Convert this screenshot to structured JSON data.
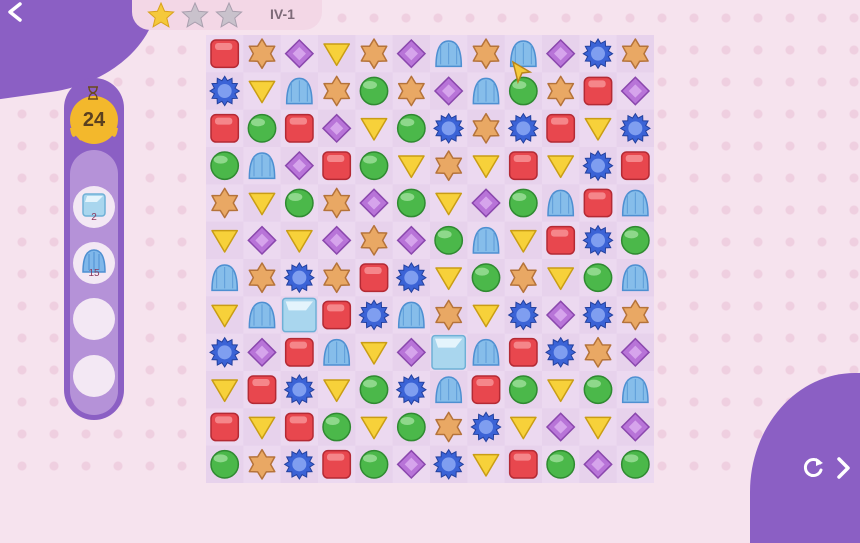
{
  "header": {
    "level_label": "IV-1",
    "stars_earned": 1,
    "stars_total": 3
  },
  "side_panel": {
    "moves_left": "24",
    "goals": [
      {
        "icon": "ice-block-icon",
        "count": "2"
      },
      {
        "icon": "blue-jelly-icon",
        "count": "15"
      },
      {
        "icon": "",
        "count": ""
      },
      {
        "icon": "",
        "count": ""
      }
    ]
  },
  "board": {
    "rows": 12,
    "cols": 12,
    "grid": [
      [
        "red-square",
        "orange-star",
        "purple-diamond",
        "yellow-triangle",
        "orange-star",
        "purple-diamond",
        "blue-jelly",
        "orange-star",
        "blue-jelly",
        "purple-diamond",
        "blue-flower",
        "orange-star"
      ],
      [
        "blue-flower",
        "yellow-triangle",
        "blue-jelly",
        "orange-star",
        "green-circle",
        "orange-star",
        "purple-diamond",
        "blue-jelly",
        "green-circle",
        "orange-star",
        "red-square",
        "purple-diamond"
      ],
      [
        "red-square",
        "green-circle",
        "red-square",
        "purple-diamond",
        "yellow-triangle",
        "green-circle",
        "blue-flower",
        "orange-star",
        "blue-flower",
        "red-square",
        "yellow-triangle",
        "blue-flower"
      ],
      [
        "green-circle",
        "blue-jelly",
        "purple-diamond",
        "red-square",
        "green-circle",
        "yellow-triangle",
        "orange-star",
        "yellow-triangle",
        "red-square",
        "yellow-triangle",
        "blue-flower",
        "red-square"
      ],
      [
        "orange-star",
        "yellow-triangle",
        "green-circle",
        "orange-star",
        "purple-diamond",
        "green-circle",
        "yellow-triangle",
        "purple-diamond",
        "green-circle",
        "blue-jelly",
        "red-square",
        "blue-jelly"
      ],
      [
        "yellow-triangle",
        "purple-diamond",
        "yellow-triangle",
        "purple-diamond",
        "orange-star",
        "purple-diamond",
        "green-circle",
        "blue-jelly",
        "yellow-triangle",
        "red-square",
        "blue-flower",
        "green-circle"
      ],
      [
        "blue-jelly",
        "orange-star",
        "blue-flower",
        "orange-star",
        "red-square",
        "blue-flower",
        "yellow-triangle",
        "green-circle",
        "orange-star",
        "yellow-triangle",
        "green-circle",
        "blue-jelly"
      ],
      [
        "yellow-triangle",
        "blue-jelly",
        "ice-block",
        "red-square",
        "blue-flower",
        "blue-jelly",
        "orange-star",
        "yellow-triangle",
        "blue-flower",
        "purple-diamond",
        "blue-flower",
        "orange-star"
      ],
      [
        "blue-flower",
        "purple-diamond",
        "red-square",
        "blue-jelly",
        "yellow-triangle",
        "purple-diamond",
        "ice-block",
        "blue-jelly",
        "red-square",
        "blue-flower",
        "orange-star",
        "purple-diamond"
      ],
      [
        "yellow-triangle",
        "red-square",
        "blue-flower",
        "yellow-triangle",
        "green-circle",
        "blue-flower",
        "blue-jelly",
        "red-square",
        "green-circle",
        "yellow-triangle",
        "green-circle",
        "blue-jelly"
      ],
      [
        "red-square",
        "yellow-triangle",
        "red-square",
        "green-circle",
        "yellow-triangle",
        "green-circle",
        "orange-star",
        "blue-flower",
        "yellow-triangle",
        "purple-diamond",
        "yellow-triangle",
        "purple-diamond"
      ],
      [
        "green-circle",
        "orange-star",
        "blue-flower",
        "red-square",
        "green-circle",
        "purple-diamond",
        "blue-flower",
        "yellow-triangle",
        "red-square",
        "green-circle",
        "purple-diamond",
        "green-circle"
      ]
    ]
  },
  "colors": {
    "accent_purple": "#8b5fc4",
    "background": "#f6e3ee",
    "moves_badge": "#f3b82c"
  },
  "controls": {
    "restart_icon": "restart-icon",
    "next_icon": "chevron-right-icon",
    "back_icon": "back-arrow-icon"
  }
}
